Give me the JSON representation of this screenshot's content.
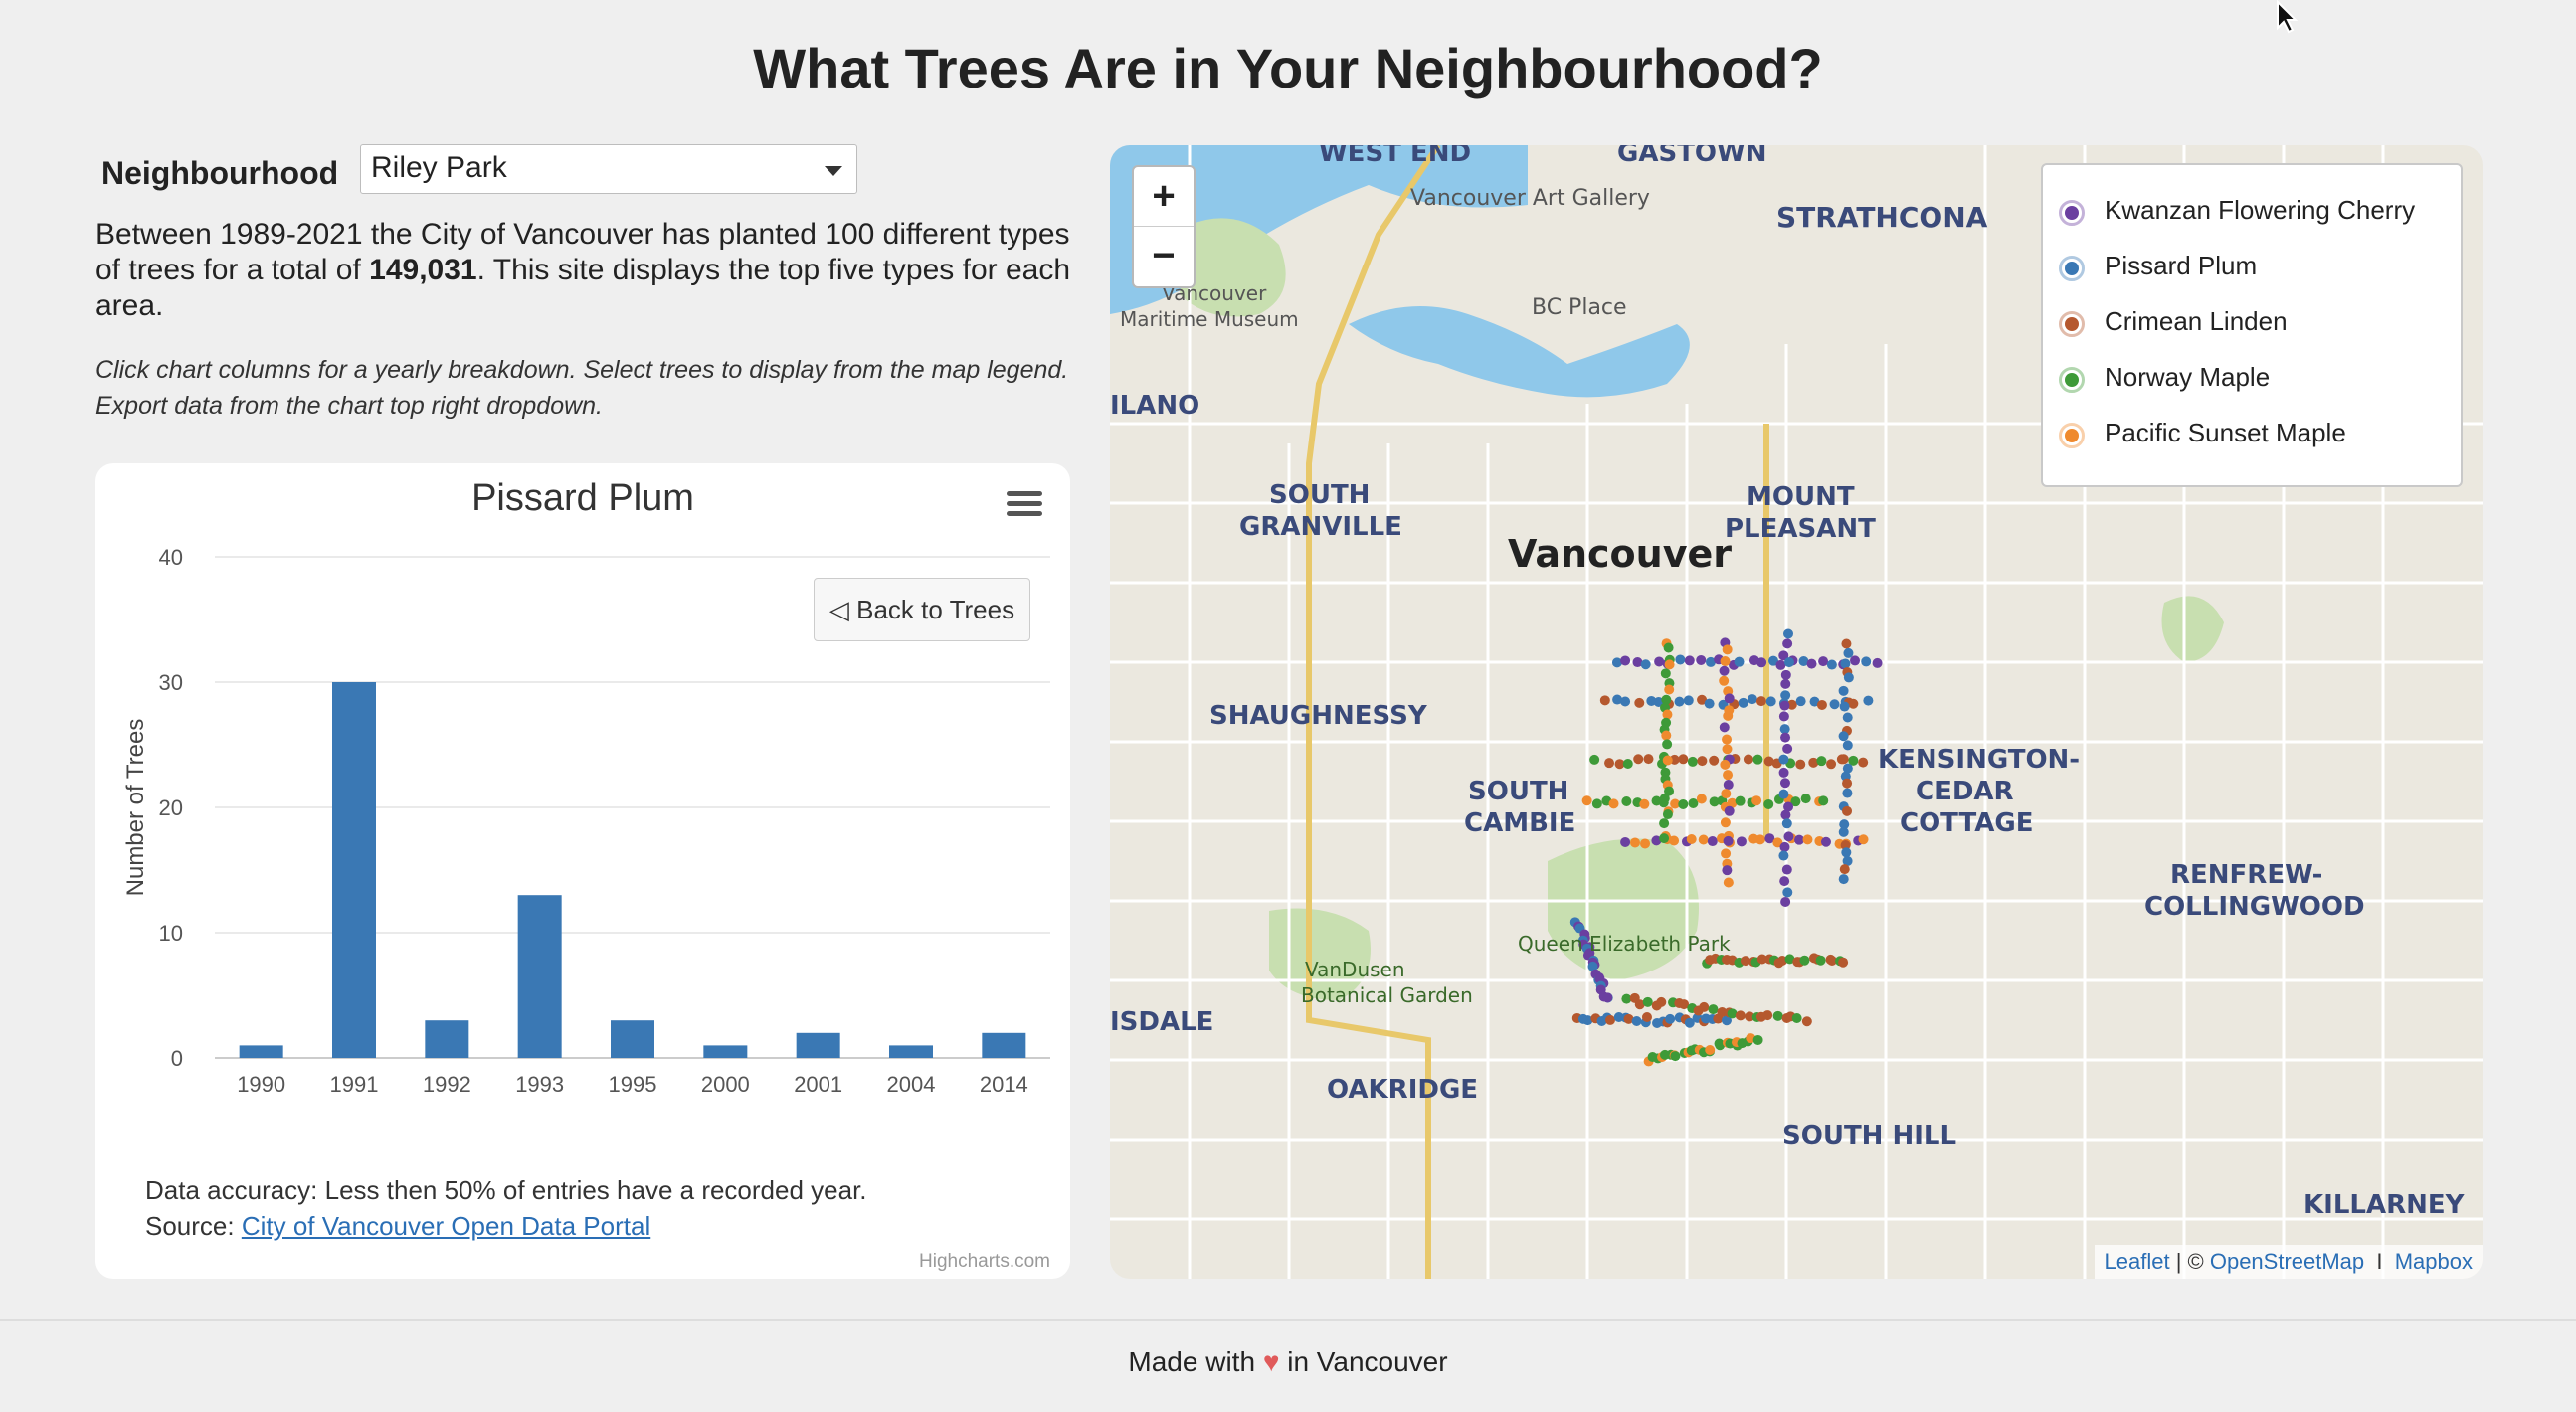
{
  "page": {
    "title": "What Trees Are in Your Neighbourhood?"
  },
  "neighbourhood": {
    "label": "Neighbourhood",
    "selected": "Riley Park"
  },
  "intro": {
    "text_before": "Between 1989-2021 the City of Vancouver has planted 100 different types of trees for a total of ",
    "total": "149,031",
    "text_after": ". This site displays the top five types for each area."
  },
  "hint": "Click chart columns for a yearly breakdown. Select trees to display from the map legend. Export data from the chart top right dropdown.",
  "chart": {
    "back_button": "◁ Back to Trees",
    "accuracy": "Data accuracy: Less then 50% of entries have a recorded year.",
    "source_prefix": "Source: ",
    "source_link": "City of Vancouver Open Data Portal",
    "credits": "Highcharts.com",
    "menu_icon": "hamburger-menu-icon",
    "bar_color": "#3a78b4"
  },
  "chart_data": {
    "type": "bar",
    "title": "Pissard Plum",
    "xlabel": "",
    "ylabel": "Number of Trees",
    "categories": [
      "1990",
      "1991",
      "1992",
      "1993",
      "1995",
      "2000",
      "2001",
      "2004",
      "2014"
    ],
    "values": [
      1,
      30,
      3,
      13,
      3,
      1,
      2,
      1,
      2
    ],
    "ylim": [
      0,
      40
    ],
    "yticks": [
      0,
      10,
      20,
      30,
      40
    ],
    "grid": true
  },
  "map": {
    "zoom_in": "+",
    "zoom_out": "−",
    "legend": [
      {
        "label": "Kwanzan Flowering Cherry",
        "color": "#6b3fa0"
      },
      {
        "label": "Pissard Plum",
        "color": "#3a78b4"
      },
      {
        "label": "Crimean Linden",
        "color": "#b5582e"
      },
      {
        "label": "Norway Maple",
        "color": "#3e9a38"
      },
      {
        "label": "Pacific Sunset Maple",
        "color": "#ef8a2e"
      }
    ],
    "labels": {
      "vancouver": "Vancouver",
      "shaughnessy": "SHAUGHNESSY",
      "south_granville_1": "SOUTH",
      "south_granville_2": "GRANVILLE",
      "mount_pleasant_1": "MOUNT",
      "mount_pleasant_2": "PLEASANT",
      "strathcona": "STRATHCONA",
      "gastown": "GASTOWN",
      "south_cambie_1": "SOUTH",
      "south_cambie_2": "CAMBIE",
      "kensington_1": "KENSINGTON-",
      "kensington_2": "CEDAR",
      "kensington_3": "COTTAGE",
      "renfrew_1": "RENFREW-",
      "renfrew_2": "COLLINGWOOD",
      "oakridge": "OAKRIDGE",
      "south_hill": "SOUTH HILL",
      "killarney": "KILLARNEY",
      "kitsilano": "ILANO",
      "kerrisdale": "ISDALE",
      "west_end": "WEST END",
      "art_gallery": "Vancouver Art Gallery",
      "bc_place": "BC Place",
      "maritime_1": "Vancouver",
      "maritime_2": "Maritime Museum",
      "queen_elizabeth": "Queen Elizabeth Park",
      "vandusen_1": "VanDusen",
      "vandusen_2": "Botanical Garden"
    },
    "attribution": {
      "leaflet": "Leaflet",
      "sep1": " | © ",
      "osm": "OpenStreetMap",
      "sep2": "  I  ",
      "mapbox": "Mapbox"
    }
  },
  "footer": {
    "before": "Made with ",
    "heart": "♥",
    "after": " in Vancouver"
  }
}
